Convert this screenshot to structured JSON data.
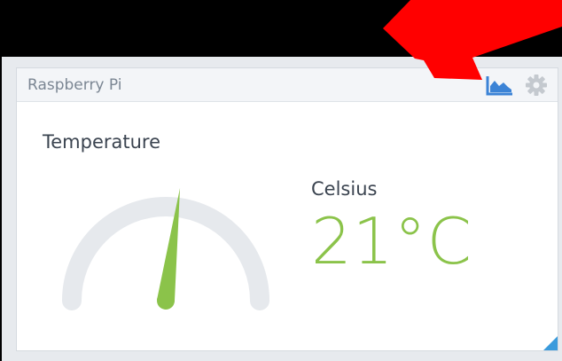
{
  "widget": {
    "title": "Raspberry Pi",
    "chart_button_icon": "area-chart-icon",
    "settings_icon": "gear-icon"
  },
  "temperature": {
    "heading": "Temperature",
    "unit_name": "Celsius",
    "display_value": "21°C",
    "gauge_fraction": 0.54
  },
  "colors": {
    "accent_blue": "#3b83d6",
    "value_green": "#8bc34a",
    "gauge_track": "#e6e9ed",
    "annotation_red": "#ff0000"
  },
  "annotation": {
    "type": "red-arrow",
    "points_to": "area-chart-icon"
  }
}
